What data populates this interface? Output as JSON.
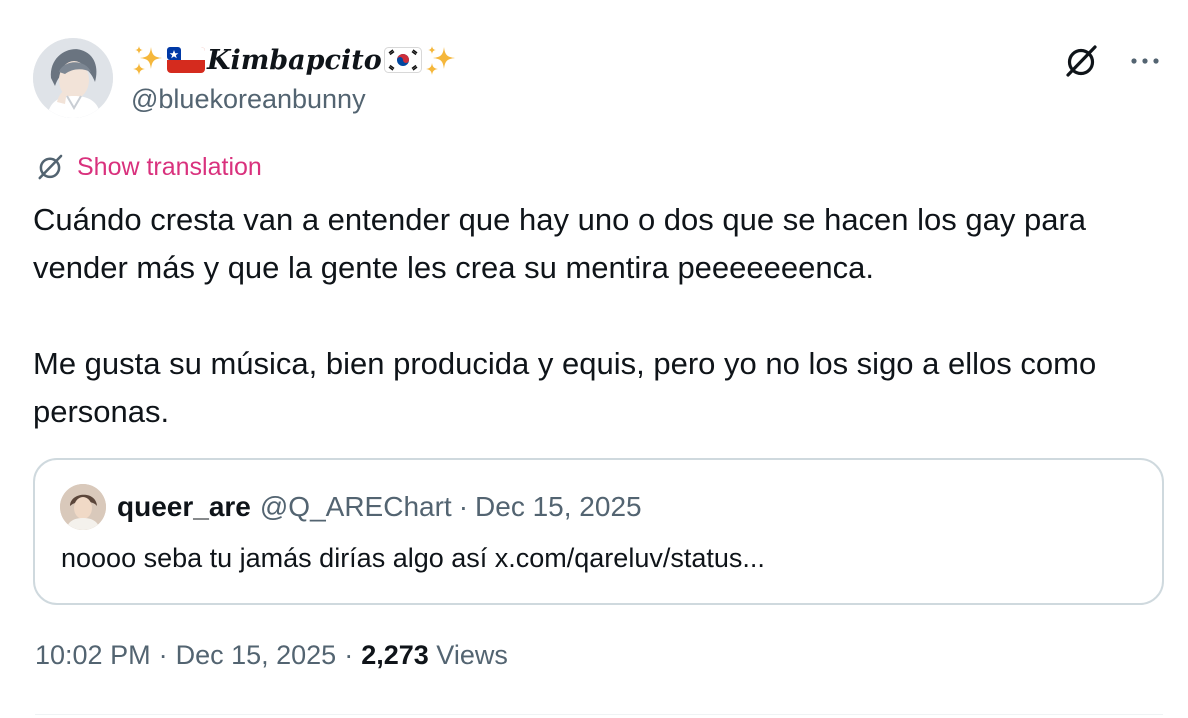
{
  "author": {
    "display_name": "Kimbapcito",
    "handle": "@bluekoreanbunny",
    "avatar_icon": "avatar-person-icon"
  },
  "actions": {
    "grok_icon": "grok-icon",
    "more_icon": "more-dots-icon"
  },
  "translation": {
    "link_text": "Show translation"
  },
  "tweet": {
    "paragraph_1": "Cuándo cresta van a entender que hay uno o dos que se hacen los gay para vender más y que la gente les crea su mentira peeeeeeenca.",
    "paragraph_2": "Me gusta su música, bien producida y equis, pero yo no los sigo a ellos como personas."
  },
  "quoted": {
    "name": "queer_are",
    "handle": "@Q_AREChart",
    "separator": "·",
    "date": "Dec 15, 2025",
    "text": "noooo seba tu jamás dirías algo así x.com/qareluv/status..."
  },
  "meta": {
    "time": "10:02 PM",
    "sep1": "·",
    "date": "Dec 15, 2025",
    "sep2": "·",
    "views_count": "2,273",
    "views_label": "Views"
  },
  "colors": {
    "translate_link": "#d9317d",
    "secondary_text": "#536471",
    "primary_text": "#0f1419",
    "border": "#cfd9de"
  }
}
